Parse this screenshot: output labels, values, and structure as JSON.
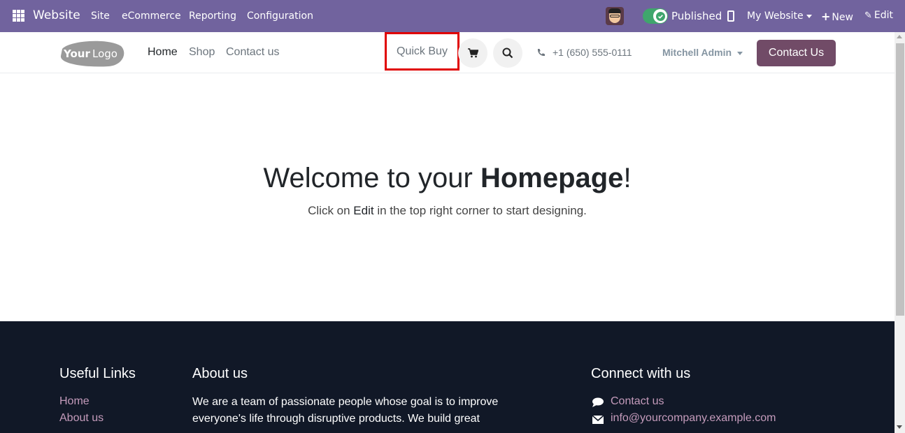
{
  "topbar": {
    "app_name": "Website",
    "menu": [
      "Site",
      "eCommerce",
      "Reporting",
      "Configuration"
    ],
    "published_label": "Published",
    "published": true,
    "website_selector": "My Website",
    "new_label": "New",
    "edit_label": "Edit",
    "bg_color": "#71639e"
  },
  "header": {
    "logo_text": "YourLogo",
    "nav": [
      "Home",
      "Shop",
      "Contact us"
    ],
    "active_nav": "Home",
    "quick_buy_label": "Quick Buy",
    "phone": "+1 (650) 555-0111",
    "user_name": "Mitchell Admin",
    "contact_button": "Contact Us",
    "accent_color": "#714b67",
    "highlight_color": "#e00000"
  },
  "hero": {
    "title_prefix": "Welcome to your ",
    "title_bold": "Homepage",
    "title_suffix": "!",
    "sub_prefix": "Click on ",
    "sub_bold": "Edit",
    "sub_suffix": " in the top right corner to start designing."
  },
  "footer": {
    "useful_links_title": "Useful Links",
    "useful_links": [
      "Home",
      "About us"
    ],
    "about_title": "About us",
    "about_text": "We are a team of passionate people whose goal is to improve everyone's life through disruptive products. We build great",
    "connect_title": "Connect with us",
    "connect_items": [
      {
        "icon": "comment-icon",
        "label": "Contact us"
      },
      {
        "icon": "envelope-icon",
        "label": "info@yourcompany.example.com"
      }
    ],
    "bg_color": "#111827"
  }
}
